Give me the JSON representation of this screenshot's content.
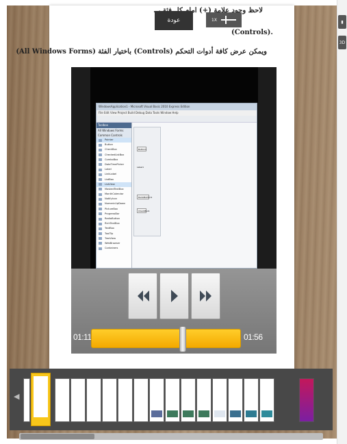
{
  "page": {
    "text_line1": "لاحظ وجود علامة (+) أمام كل فئة ، ... بظهور مجموعة من أدوات التحكم",
    "text_line2": "(Controls).",
    "text_line3": "ويمكن عرض كافة أدوات التحكم (Controls) باختيار الفئة (All Windows Forms)"
  },
  "overlay": {
    "back_label": "عودة",
    "zoom_label": "1X"
  },
  "side_buttons": [
    "▮",
    "3D"
  ],
  "player": {
    "current_time": "01:11",
    "total_time": "01:56",
    "progress": 0.61,
    "rewind_icon": "rewind-icon",
    "play_icon": "play-icon",
    "forward_icon": "fast-forward-icon"
  },
  "video_app": {
    "title": "WindowsApplication1 - Microsoft Visual Basic 2010 Express Edition",
    "menu": "File  Edit  View  Project  Build  Debug  Data  Tools  Window  Help",
    "toolbox_title": "Toolbox",
    "toolbox_section_all": "All Windows Forms",
    "toolbox_section_common": "Common Controls",
    "toolbox_items": [
      "Pointer",
      "Button",
      "CheckBox",
      "CheckedListBox",
      "ComboBox",
      "DateTimePicker",
      "Label",
      "LinkLabel",
      "ListBox",
      "ListView",
      "MaskedTextBox",
      "MonthCalendar",
      "NotifyIcon",
      "NumericUpDown",
      "PictureBox",
      "ProgressBar",
      "RadioButton",
      "RichTextBox",
      "TextBox",
      "ToolTip",
      "TreeView",
      "WebBrowser",
      "Containers"
    ],
    "form_buttons": [
      "Button1",
      "RadioButton1",
      "CheckBox1"
    ],
    "form_label": "Label1"
  },
  "thumbnails": {
    "count": 17,
    "active_index": 1
  }
}
